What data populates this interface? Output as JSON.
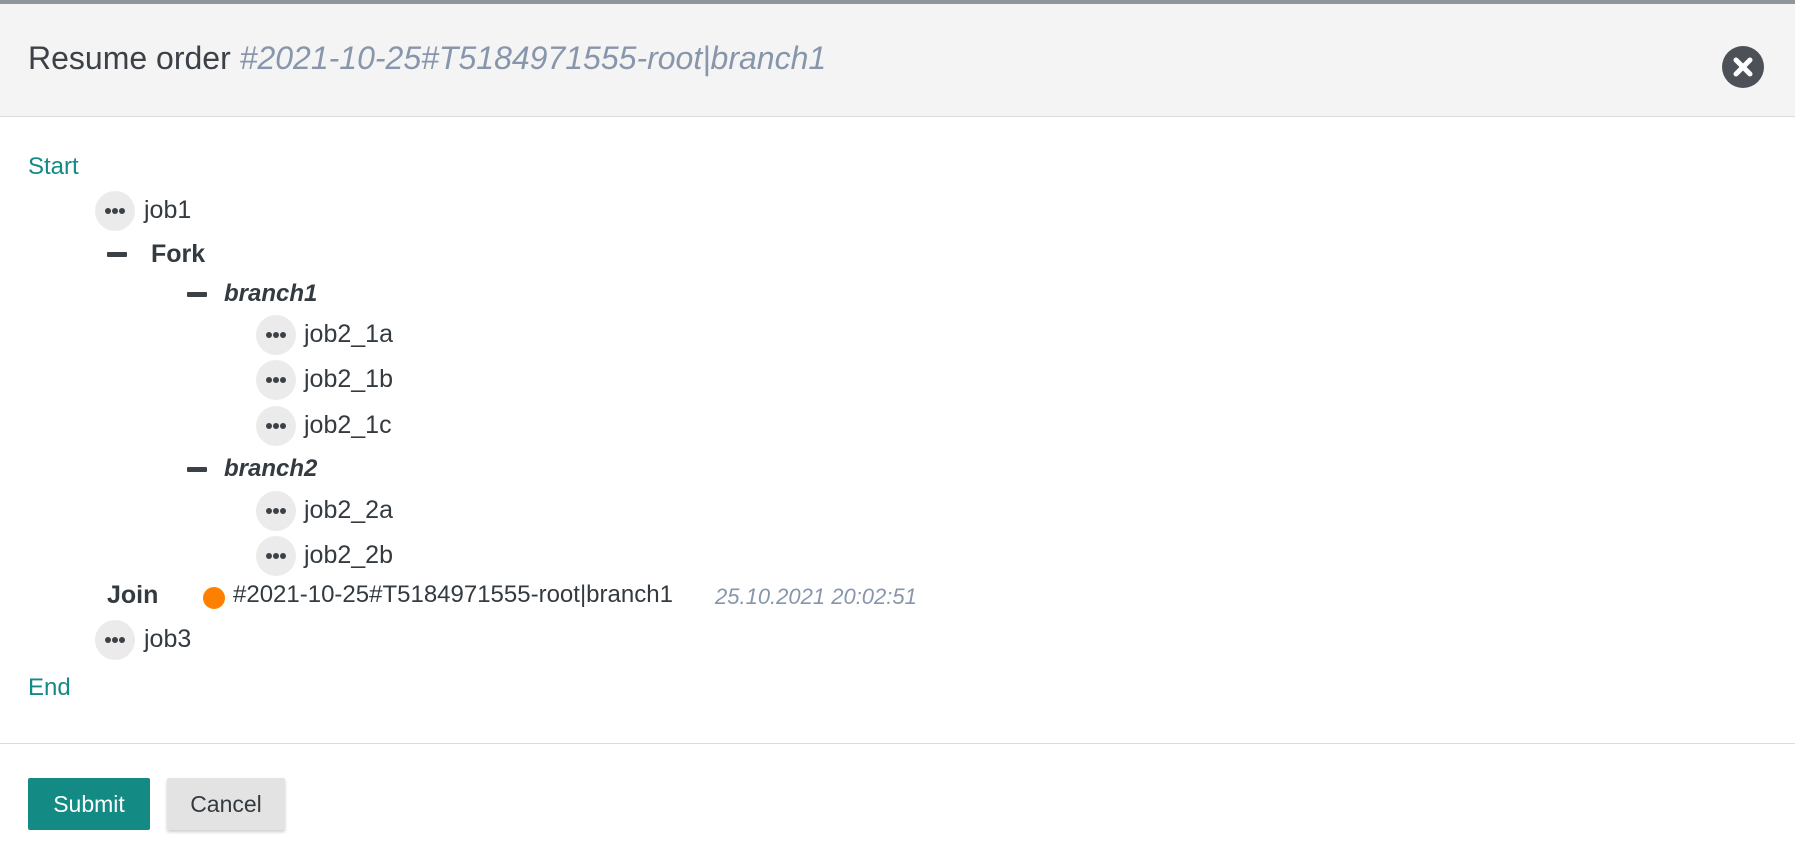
{
  "dialog": {
    "title_prefix": "Resume order",
    "order_id": "#2021-10-25#T5184971555-root|branch1"
  },
  "workflow": {
    "start_label": "Start",
    "end_label": "End",
    "job1": "job1",
    "fork_label": "Fork",
    "branches": [
      {
        "label": "branch1",
        "jobs": [
          "job2_1a",
          "job2_1b",
          "job2_1c"
        ]
      },
      {
        "label": "branch2",
        "jobs": [
          "job2_2a",
          "job2_2b"
        ]
      }
    ],
    "join_label": "Join",
    "join_order": {
      "id": "#2021-10-25#T5184971555-root|branch1",
      "timestamp": "25.10.2021 20:02:51",
      "state_color": "#ff8000"
    },
    "job3": "job3"
  },
  "footer": {
    "submit_label": "Submit",
    "cancel_label": "Cancel"
  },
  "colors": {
    "accent": "#148a84",
    "muted": "#8796ab",
    "header_bg": "#f4f4f4"
  },
  "icons": {
    "close": "close-circle-icon",
    "more": "ellipsis-icon",
    "collapse": "minus-icon"
  }
}
